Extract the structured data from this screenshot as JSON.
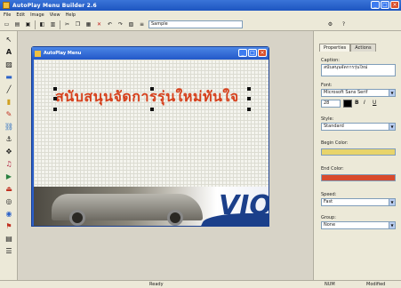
{
  "app": {
    "title": "AutoPlay Menu Builder 2.6"
  },
  "menu": [
    "File",
    "Edit",
    "Image",
    "View",
    "Help"
  ],
  "toolbar": {
    "filename_value": "Sample"
  },
  "document": {
    "title": "AutoPlay Menu"
  },
  "canvas": {
    "text": "สนับสนุนจัดการรุ่นใหม่ทันใจ",
    "text_color": "#d6401c",
    "banner_word": "VIO"
  },
  "properties": {
    "tabs": [
      "Properties",
      "Actions"
    ],
    "caption_label": "Caption:",
    "caption_value": "สนับสนุนจัดการรุ่นใหม่",
    "font_label": "Font:",
    "font_value": "Microsoft Sans Serif",
    "size_value": "28",
    "style_label": "Style:",
    "style_value": "Standard",
    "begin_color_label": "Begin Color:",
    "begin_color": "#e8d46a",
    "end_color_label": "End Color:",
    "end_color": "#d84a2c",
    "speed_label": "Speed:",
    "speed_value": "Fast",
    "group_label": "Group:",
    "group_value": "None"
  },
  "status": {
    "center": "Ready",
    "right1": "NUM",
    "right2": "Modified"
  }
}
